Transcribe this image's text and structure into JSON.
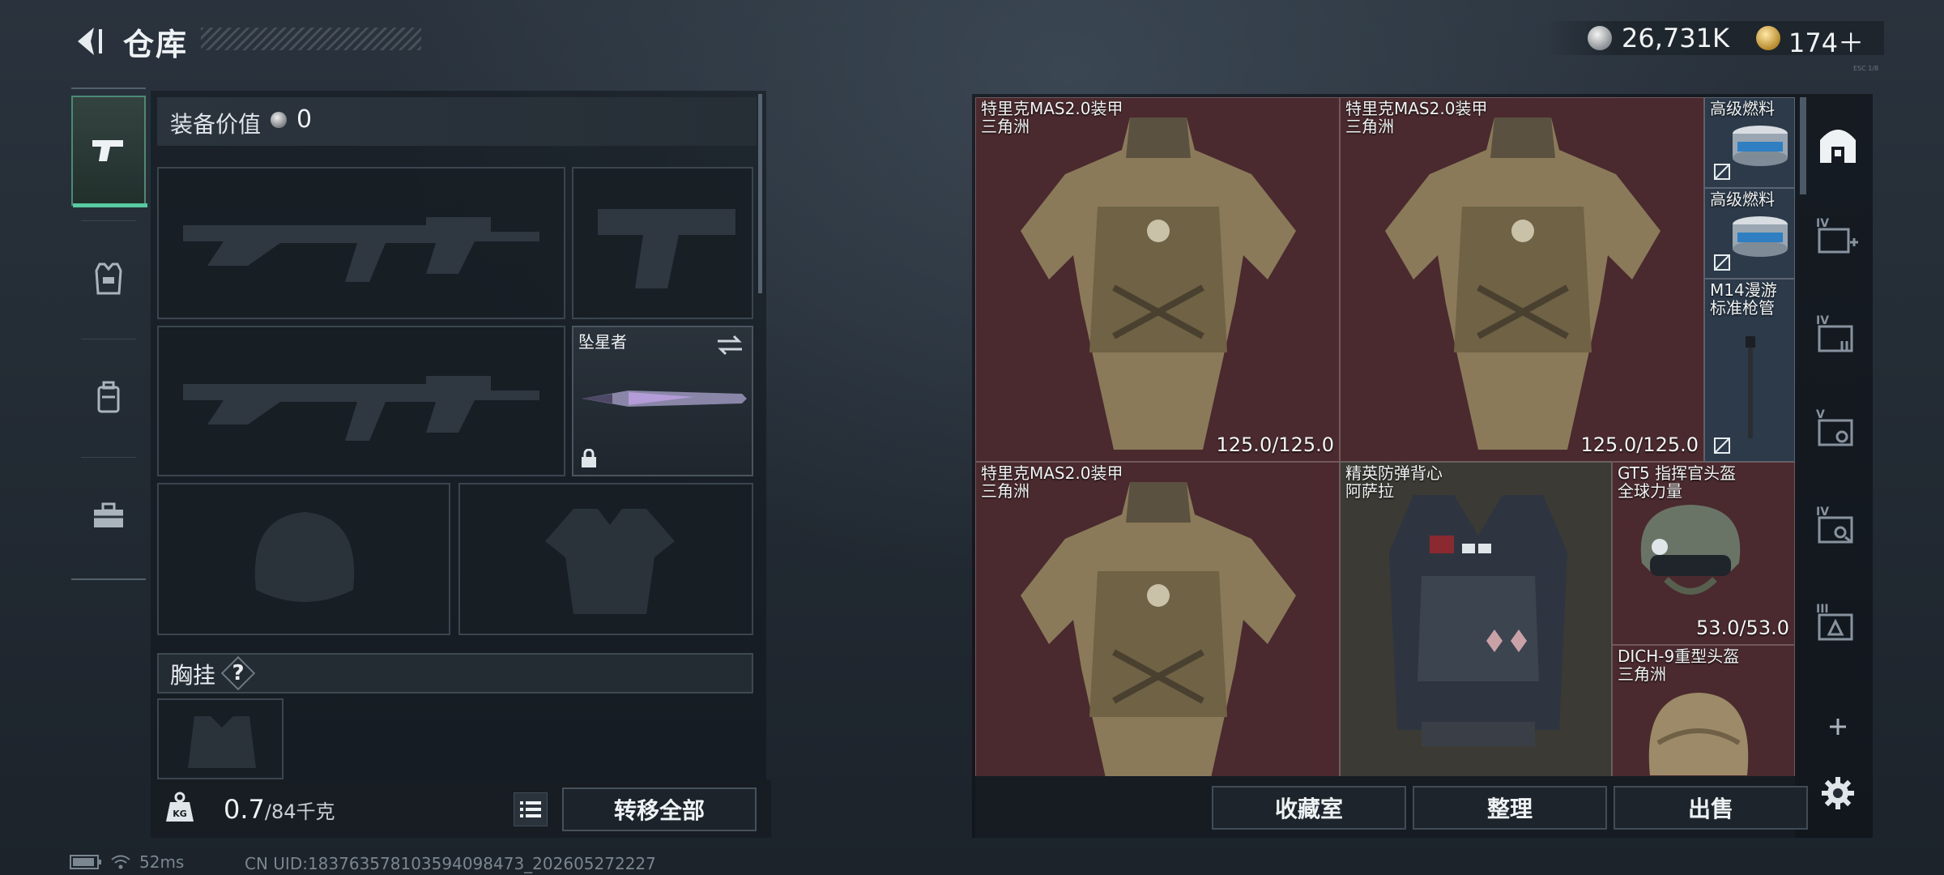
{
  "header": {
    "title": "仓库"
  },
  "currency": {
    "primary": "26,731K",
    "secondary": "174＋",
    "hint": "ESC 1/8"
  },
  "left_tabs": [
    "weapon-tab",
    "armor-tab",
    "backpack-tab",
    "toolbox-tab"
  ],
  "equipment": {
    "value_label": "装备价值",
    "value": "0",
    "melee_name": "坠星者",
    "chest_label": "胸挂",
    "chest_help": "?"
  },
  "bottom_left": {
    "weight_current": "0.7",
    "weight_capacity": "/84千克",
    "transfer_all": "转移全部"
  },
  "status": {
    "ping": "52ms",
    "uid": "CN UID:1837635781035940984​73_202605272227"
  },
  "stash_items": [
    {
      "name_line1": "特里克MAS2.0装甲",
      "name_line2": "三角洲",
      "durability": "125.0/125.0"
    },
    {
      "name_line1": "特里克MAS2.0装甲",
      "name_line2": "三角洲",
      "durability": "125.0/125.0"
    },
    {
      "name_line1": "高级燃料",
      "name_line2": "",
      "durability": ""
    },
    {
      "name_line1": "高级燃料",
      "name_line2": "",
      "durability": ""
    },
    {
      "name_line1": "M14漫游",
      "name_line2": "标准枪管",
      "durability": ""
    },
    {
      "name_line1": "特里克MAS2.0装甲",
      "name_line2": "三角洲",
      "durability": ""
    },
    {
      "name_line1": "精英防弹背心",
      "name_line2": "阿萨拉",
      "durability": ""
    },
    {
      "name_line1": "GT5 指挥官头盔",
      "name_line2": "全球力量",
      "durability": "53.0/53.0"
    },
    {
      "name_line1": "DICH-9重型头盔",
      "name_line2": "三角洲",
      "durability": ""
    }
  ],
  "stash_actions": {
    "collection": "收藏室",
    "organize": "整理",
    "sell": "出售"
  },
  "right_icons": [
    {
      "level": "",
      "icon": "stash-main-icon"
    },
    {
      "level": "IV",
      "icon": "case-add-icon"
    },
    {
      "level": "IV",
      "icon": "case-icon"
    },
    {
      "level": "V",
      "icon": "case-icon"
    },
    {
      "level": "IV",
      "icon": "case-icon"
    },
    {
      "level": "III",
      "icon": "case-icon"
    },
    {
      "level": "",
      "icon": "plus-icon"
    },
    {
      "level": "",
      "icon": "gear-icon"
    }
  ],
  "colors": {
    "accent": "#58c9a0",
    "stash_bg": "#3a2024"
  }
}
